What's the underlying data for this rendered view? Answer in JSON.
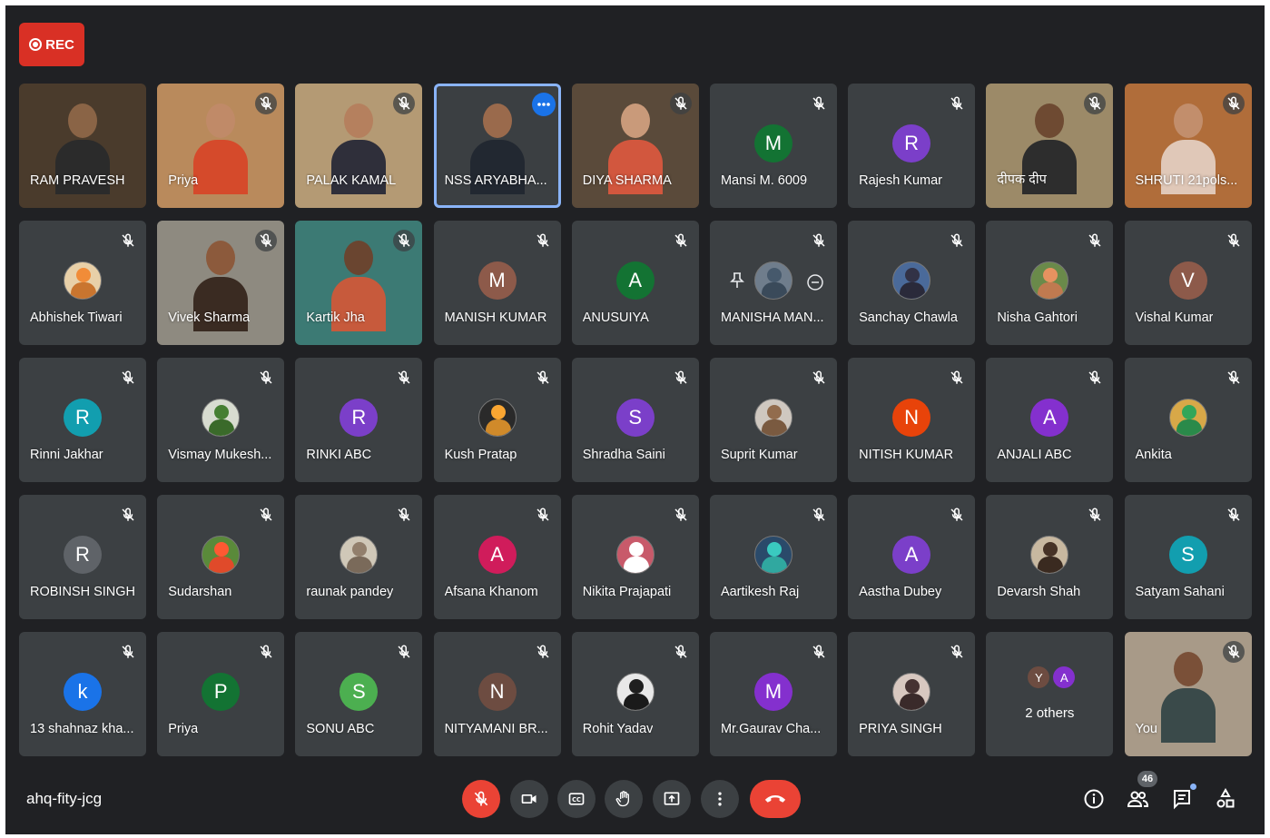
{
  "recording": {
    "label": "REC"
  },
  "participants": [
    {
      "name": "RAM PRAVESH",
      "type": "video",
      "bg": "#4a3b2c",
      "skin": "#8a6446",
      "shirt": "#2b2b2b",
      "mic": "none"
    },
    {
      "name": "Priya",
      "type": "video",
      "bg": "#b98a5c",
      "skin": "#c08a68",
      "shirt": "#d54a2b",
      "mic": "muted"
    },
    {
      "name": "PALAK KAMAL",
      "type": "video",
      "bg": "#b49a74",
      "skin": "#b5805e",
      "shirt": "#2f2f3a",
      "mic": "muted"
    },
    {
      "name": "NSS ARYABHA...",
      "type": "video",
      "bg": "#3b3f42",
      "skin": "#9a6a4c",
      "shirt": "#222831",
      "mic": "more",
      "active": true
    },
    {
      "name": "DIYA SHARMA",
      "type": "video",
      "bg": "#5a4a3a",
      "skin": "#c99a7a",
      "shirt": "#d2573e",
      "mic": "muted"
    },
    {
      "name": "Mansi M. 6009",
      "type": "avatar",
      "initial": "M",
      "color": "#137333",
      "mic": "muted"
    },
    {
      "name": "Rajesh Kumar",
      "type": "avatar",
      "initial": "R",
      "color": "#7b3fc9",
      "mic": "muted"
    },
    {
      "name": "दीपक दीप",
      "type": "video",
      "bg": "#9c8a68",
      "skin": "#6e4a32",
      "shirt": "#2d2d2d",
      "mic": "muted"
    },
    {
      "name": "SHRUTI 21pols...",
      "type": "video",
      "bg": "#b06d3a",
      "skin": "#c28e6c",
      "shirt": "#e0c8b8",
      "mic": "muted"
    },
    {
      "name": "Abhishek Tiwari",
      "type": "photo",
      "bg": "#e8d0a8",
      "fig": "#c9752f",
      "mic": "muted"
    },
    {
      "name": "Vivek Sharma",
      "type": "video",
      "bg": "#8e8a80",
      "skin": "#8c5a3c",
      "shirt": "#3a2b22",
      "mic": "muted"
    },
    {
      "name": "Kartik Jha",
      "type": "video",
      "bg": "#3c7a74",
      "skin": "#6a4530",
      "shirt": "#c75a3c",
      "mic": "muted"
    },
    {
      "name": "MANISH KUMAR",
      "type": "avatar",
      "initial": "M",
      "color": "#8d5a4a",
      "mic": "muted"
    },
    {
      "name": "ANUSUIYA",
      "type": "avatar",
      "initial": "A",
      "color": "#137333",
      "mic": "muted"
    },
    {
      "name": "MANISHA MAN...",
      "type": "photo",
      "bg": "#6f7d8c",
      "fig": "#3a4a5a",
      "mic": "muted",
      "pinned": true
    },
    {
      "name": "Sanchay Chawla",
      "type": "photo",
      "bg": "#4a6a9a",
      "fig": "#2a2a3a",
      "mic": "muted"
    },
    {
      "name": "Nisha Gahtori",
      "type": "photo",
      "bg": "#6a8a4a",
      "fig": "#c07a50",
      "mic": "muted"
    },
    {
      "name": "Vishal Kumar",
      "type": "avatar",
      "initial": "V",
      "color": "#8d5a4a",
      "mic": "muted"
    },
    {
      "name": "Rinni Jakhar",
      "type": "avatar",
      "initial": "R",
      "color": "#129eaf",
      "mic": "muted"
    },
    {
      "name": "Vismay Mukesh...",
      "type": "photo",
      "bg": "#d8dcd0",
      "fig": "#3a6a2a",
      "mic": "muted"
    },
    {
      "name": "RINKI ABC",
      "type": "avatar",
      "initial": "R",
      "color": "#7b3fc9",
      "mic": "muted"
    },
    {
      "name": "Kush Pratap",
      "type": "photo",
      "bg": "#2a2a2a",
      "fig": "#d08a2a",
      "mic": "muted"
    },
    {
      "name": "Shradha Saini",
      "type": "avatar",
      "initial": "S",
      "color": "#7b3fc9",
      "mic": "muted"
    },
    {
      "name": "Suprit Kumar",
      "type": "photo",
      "bg": "#cfc8c0",
      "fig": "#7a5a40",
      "mic": "muted"
    },
    {
      "name": "NITISH KUMAR",
      "type": "avatar",
      "initial": "N",
      "color": "#e8430a",
      "mic": "muted"
    },
    {
      "name": "ANJALI ABC",
      "type": "avatar",
      "initial": "A",
      "color": "#8430ce",
      "mic": "muted"
    },
    {
      "name": "Ankita",
      "type": "photo",
      "bg": "#d8a848",
      "fig": "#2a8a4a",
      "mic": "muted"
    },
    {
      "name": "ROBINSH SINGH",
      "type": "avatar",
      "initial": "R",
      "color": "#5f6368",
      "mic": "muted"
    },
    {
      "name": "Sudarshan",
      "type": "photo",
      "bg": "#5a8a3a",
      "fig": "#e04a2a",
      "mic": "muted"
    },
    {
      "name": "raunak pandey",
      "type": "photo",
      "bg": "#d0c8b8",
      "fig": "#7a6a5a",
      "mic": "muted"
    },
    {
      "name": "Afsana Khanom",
      "type": "avatar",
      "initial": "A",
      "color": "#d01c5b",
      "mic": "muted"
    },
    {
      "name": "Nikita Prajapati",
      "type": "photo",
      "bg": "#c85a6a",
      "fig": "#ffffff",
      "mic": "muted"
    },
    {
      "name": "Aartikesh Raj",
      "type": "photo",
      "bg": "#2a4a6a",
      "fig": "#30a8a0",
      "mic": "muted"
    },
    {
      "name": "Aastha Dubey",
      "type": "avatar",
      "initial": "A",
      "color": "#7b3fc9",
      "mic": "muted"
    },
    {
      "name": "Devarsh Shah",
      "type": "photo",
      "bg": "#c8b8a0",
      "fig": "#3a2a20",
      "mic": "muted"
    },
    {
      "name": "Satyam Sahani",
      "type": "avatar",
      "initial": "S",
      "color": "#129eaf",
      "mic": "muted"
    },
    {
      "name": "13 shahnaz kha...",
      "type": "avatar",
      "initial": "k",
      "color": "#1a73e8",
      "mic": "muted"
    },
    {
      "name": "Priya",
      "type": "avatar",
      "initial": "P",
      "color": "#137333",
      "mic": "muted"
    },
    {
      "name": "SONU ABC",
      "type": "avatar",
      "initial": "S",
      "color": "#4caf50",
      "mic": "muted"
    },
    {
      "name": "NITYAMANI BR...",
      "type": "avatar",
      "initial": "N",
      "color": "#6d4c41",
      "mic": "muted"
    },
    {
      "name": "Rohit Yadav",
      "type": "photo",
      "bg": "#e8e8e8",
      "fig": "#1a1a1a",
      "mic": "muted"
    },
    {
      "name": "Mr.Gaurav Cha...",
      "type": "avatar",
      "initial": "M",
      "color": "#8430ce",
      "mic": "muted"
    },
    {
      "name": "PRIYA SINGH",
      "type": "photo",
      "bg": "#d8c8c0",
      "fig": "#3a2a2a",
      "mic": "muted"
    },
    {
      "name": "2 others",
      "type": "others",
      "initials": [
        "Y",
        "A"
      ],
      "colors": [
        "#6d4c41",
        "#8430ce"
      ],
      "mic": "none"
    },
    {
      "name": "You",
      "type": "video",
      "bg": "#a89a88",
      "skin": "#7a5038",
      "shirt": "#3a4a4a",
      "mic": "bubble"
    }
  ],
  "meeting": {
    "code": "ahq-fity-jcg",
    "participant_count": "46"
  },
  "controls": {
    "mic": "mic-off-icon",
    "camera": "camera-icon",
    "captions": "captions-icon",
    "raise_hand": "raise-hand-icon",
    "present": "present-screen-icon",
    "more": "more-options-icon",
    "leave": "leave-call-icon",
    "info": "info-icon",
    "people": "people-icon",
    "chat": "chat-icon",
    "activities": "activities-icon"
  }
}
